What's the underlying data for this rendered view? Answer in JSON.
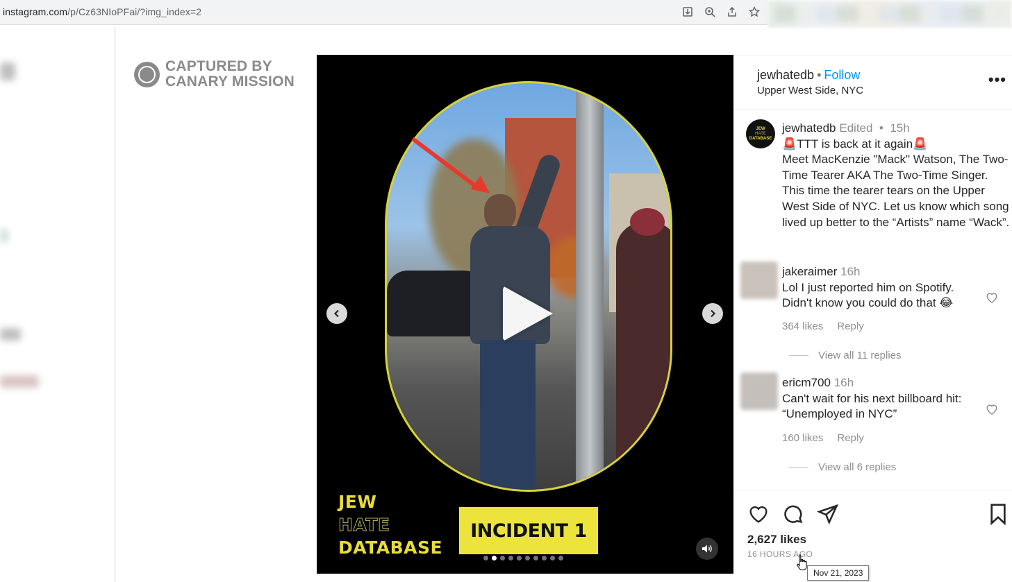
{
  "browser": {
    "url_host": "instagram.com",
    "url_path": "/p/Cz63NIoPFai/?img_index=2",
    "icons": [
      "download-icon",
      "zoom-icon",
      "share-icon",
      "star-icon"
    ]
  },
  "watermark": {
    "line1": "CAPTURED BY",
    "line2": "CANARY MISSION"
  },
  "media": {
    "overlay_lines": [
      "JEW",
      "HATE",
      "DATABASE"
    ],
    "incident_label": "INCIDENT 1",
    "slide_count": 10,
    "active_slide": 2
  },
  "post": {
    "username": "jewhatedb",
    "follow_label": "Follow",
    "location": "Upper West Side, NYC",
    "caption": {
      "username": "jewhatedb",
      "edited": "Edited",
      "time": "15h",
      "line1": "🚨TTT is back at it again🚨",
      "text": "Meet MacKenzie \"Mack\" Watson, The Two-Time Tearer AKA The Two-Time Singer. This time the tearer tears on the Upper West Side of NYC. Let us know which song lived up better to the “Artists” name “Wack”.",
      "avatar_lines": [
        "JEW",
        "HATE",
        "DATABASE"
      ]
    },
    "comments": [
      {
        "username": "jakeraimer",
        "time": "16h",
        "text": "Lol I just reported him on Spotify. Didn't know you could do that 😂",
        "likes": "364 likes",
        "reply": "Reply",
        "view_replies": "View all 11 replies"
      },
      {
        "username": "ericm700",
        "time": "16h",
        "text": "Can't wait for his next billboard hit: “Unemployed in NYC”",
        "likes": "160 likes",
        "reply": "Reply",
        "view_replies": "View all 6 replies"
      }
    ],
    "likes": "2,627 likes",
    "time_ago": "16 HOURS AGO",
    "tooltip": "Nov 21, 2023"
  },
  "colors": {
    "link_blue": "#0095f6",
    "brand_yellow": "#e8dc36",
    "arrow_red": "#e53b2f"
  }
}
